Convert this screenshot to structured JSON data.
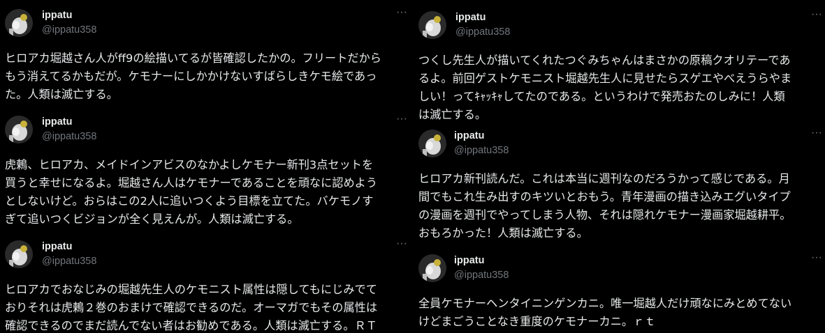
{
  "author": {
    "name": "ippatu",
    "handle": "@ippatu358",
    "more_label": "···"
  },
  "colors": {
    "background": "#000000",
    "text": "#e7e9ea",
    "secondary": "#71767b"
  },
  "left_column": {
    "posts": [
      {
        "text": "ヒロアカ堀越さん人がff9の絵描いてるが皆確認したかの。フリートだから\nもう消えてるかもだが。ケモナーにしかかけないすばらしきケモ絵であっ\nた。人類は滅亡する。"
      },
      {
        "text": "虎鶫、ヒロアカ、メイドインアビスのなかよしケモナー新刊3点セットを\n買うと幸せになるよ。堀越さん人はケモナーであることを頑なに認めよう\nとしないけど。おらはこの2人に追いつくよう目標を立てた。バケモノす\nぎて追いつくビジョンが全く見えんが。人類は滅亡する。"
      },
      {
        "text": "ヒロアカでおなじみの堀越先生人のケモニスト属性は隠してもにじみでて\nおりそれは虎鶫２巻のおまけで確認できるのだ。オーマガでもその属性は\n確認できるのでまだ読んでない者はお勧めである。人類は滅亡する。ＲＴ"
      }
    ]
  },
  "right_column": {
    "posts": [
      {
        "text": "つくし先生人が描いてくれたつぐみちゃんはまさかの原稿クオリテーであ\nるよ。前回ゲストケモニスト堀越先生人に見せたらスゲエやべえうらやま\nしい！ってｷｬｯｷｬしてたのである。というわけで発売おたのしみに！人類\nは滅亡する。"
      },
      {
        "text": "ヒロアカ新刊読んだ。これは本当に週刊なのだろうかって感じである。月\n間でもこれ生み出すのキツいとおもう。青年漫画の描き込みエグいタイプ\nの漫画を週刊でやってしまう人物、それは隠れケモナー漫画家堀越耕平。\nおもろかった！人類は滅亡する。"
      },
      {
        "text": "全員ケモナーヘンタイニンゲンカニ。唯一堀越人だけ頑なにみとめてない\nけどまごうことなき重度のケモナーカニ。ｒｔ"
      }
    ]
  }
}
